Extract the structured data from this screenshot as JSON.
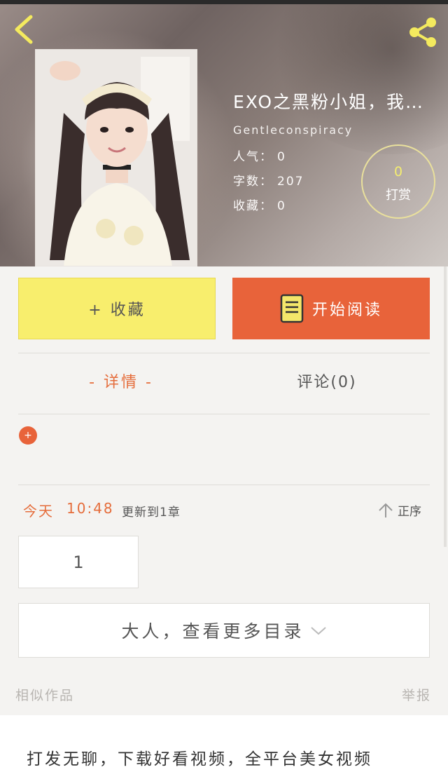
{
  "header": {
    "back_icon": "chevron-left-icon",
    "share_icon": "share-icon"
  },
  "book": {
    "title": "EXO之黑粉小姐，我…",
    "author": "Gentleconspiracy",
    "stats": [
      {
        "label": "人气：",
        "value": "0"
      },
      {
        "label": "字数：",
        "value": "207"
      },
      {
        "label": "收藏：",
        "value": "0"
      }
    ],
    "reward_count": "0",
    "reward_label": "打赏"
  },
  "actions": {
    "favorite_label": "+ 收藏",
    "read_label": "开始阅读",
    "read_icon": "book-icon"
  },
  "tabs": {
    "detail": "- 详情 -",
    "comments": "评论(0)"
  },
  "update": {
    "today": "今天",
    "time": "10:48",
    "text": "更新到1章",
    "sort_label": "正序",
    "sort_icon": "arrow-up-icon"
  },
  "chapters": [
    "1"
  ],
  "more_catalog": "大人，查看更多目录",
  "footer": {
    "similar": "相似作品",
    "report": "举报"
  },
  "ad": {
    "text": "打发无聊，下载好看视频，全平台美女视频"
  },
  "colors": {
    "accent": "#e8633a",
    "favorite_bg": "#f8ee6d",
    "reward_border": "#e9e09c"
  }
}
